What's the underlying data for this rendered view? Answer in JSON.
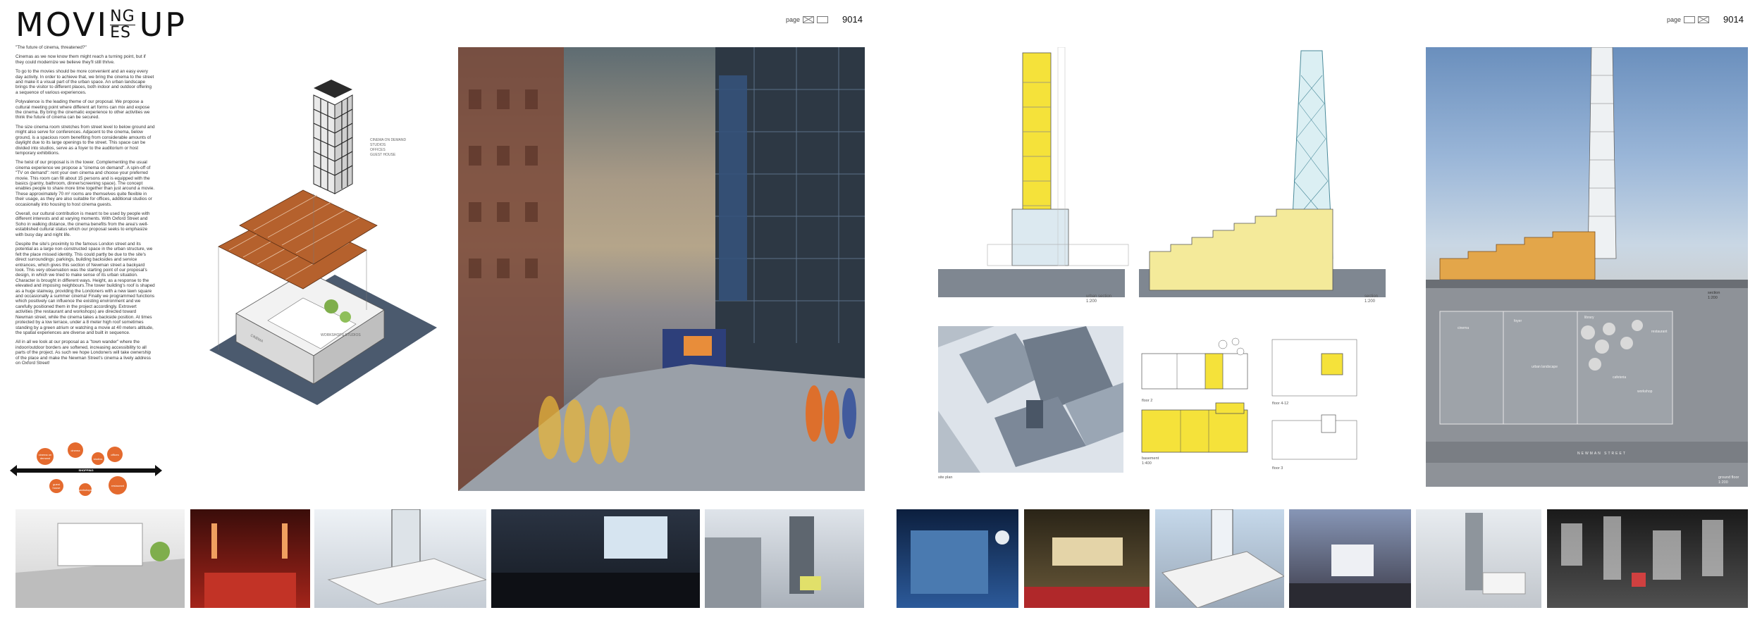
{
  "title": {
    "part1": "MOVI",
    "stack_top": "NG",
    "stack_bottom": "ES",
    "part2": "UP"
  },
  "page_info_left": {
    "label": "page",
    "number": "9014"
  },
  "page_info_right": {
    "label": "page",
    "number": "9014"
  },
  "body_text": [
    "\"The future of cinema, threatened?\"",
    "Cinemas as we now know them might reach a turning point, but if they could modernize we believe they'll still thrive.",
    "To go to the movies should be more convenient and an easy every day activity. In order to achieve that, we bring the cinema to the street and make it a visual part of the urban space. An urban landscape brings the visitor to different places, both indoor and outdoor offering a sequence of various experiences.",
    "Polyvalence is the leading theme of our proposal. We propose a cultural meeting point where different art forms can mix and expose the cinema. By bring the cinematic experience to other activities we think the future of cinema can be secured.",
    "The size cinema room stretches from street level to below ground and might also serve for conferences. Adjacent to the cinema, below ground, is a spacious room benefiting from considerable amounts of daylight due to its large openings to the street. This space can be divided into studios, serve as a foyer to the auditorium or host temporary exhibitions.",
    "The twist of our proposal is in the tower. Complementing the usual cinema experience we propose a \"cinema on demand\". A spin-off of \"TV on demand\": rent your own cinema and choose your preferred movie. This room can fill about 15 persons and is equipped with the basics (pantry, bathroom, dinner/screening space). The concept enables people to share more time together than just around a movie. These approximately 70 m² rooms are themselves quite flexible in their usage, as they are also suitable for offices, additional studios or occasionally into housing to host cinema guests.",
    "Overall, our cultural contribution is meant to be used by people with different interests and at varying moments. With Oxford Street and Soho in walking distance, the cinema benefits from the area's well-established cultural status which our proposal seeks to emphasize with busy day and night life.",
    "Despite the site's proximity to the famous London street and its potential as a large non-constructed space in the urban structure, we felt the place missed identity. This could partly be due to the site's direct surroundings: parkings, building backsides and service entrances, which gives this section of Newman street a backyard look. This very observation was the starting point of our proposal's design, in which we tried to make sense of its urban situation. Character is brought in different ways. Height, as a response to the elevated and imposing neighbours.The tower building's roof is shaped as a huge stairway, providing the Londoners with a new lawn square and occasionally a summer cinema! Finally we programmed functions which positively can influence the existing environment and we carefully positioned them in the project accordingly. Extrovert activities (the restaurant and workshops) are directed toward Newman street, while the cinema takes a backside position. At times protected by a low terrace, under a 8 meter high roof sometimes standing by a green atrium or watching a movie at 40 meters altitude, the spatial experiences are diverse and built in sequence.",
    "All in all we look at our proposal as a \"town wander\" where the indoor/outdoor borders are softened, increasing accessibility to all parts of the project. As such we hope Londoners will take ownership of the place and make the Newman Street's cinema a lively address on Oxford Street!"
  ],
  "diagram": {
    "shopping_label": "SHOPPING",
    "circles": [
      "cinema on demand",
      "cinema",
      "studios",
      "offices",
      "guest house",
      "workshops",
      "restaurant"
    ]
  },
  "axo_labels": {
    "tower": [
      "CINEMA ON DEMAND",
      "STUDIOS",
      "OFFICES",
      "GUEST HOUSE"
    ],
    "base_left": "CINEMA",
    "base_right": "WORKSHOPS STUDIOS"
  },
  "drawing_labels": {
    "urban_section": [
      "urban section",
      "1:200"
    ],
    "section": [
      "section",
      "1:200"
    ],
    "render_section": [
      "section",
      "1:200"
    ],
    "site_plan": "site plan",
    "floor2": "floor 2",
    "floor4_12": "floor 4-12",
    "basement": [
      "basement",
      "1:400"
    ],
    "floor3": "floor 3",
    "ground_floor": [
      "ground floor",
      "1:200"
    ],
    "street_name": "NEWMAN STREET"
  },
  "plan_labels": {
    "ground": [
      "cinema",
      "foyer",
      "urban landscape",
      "restaurant",
      "cafeteria",
      "library",
      "workshop"
    ]
  },
  "colors": {
    "accent": "#e46a2e",
    "plan_yellow": "#f5e23a",
    "tower_frame": "#2b2b2b",
    "deck": "#b5612d"
  }
}
